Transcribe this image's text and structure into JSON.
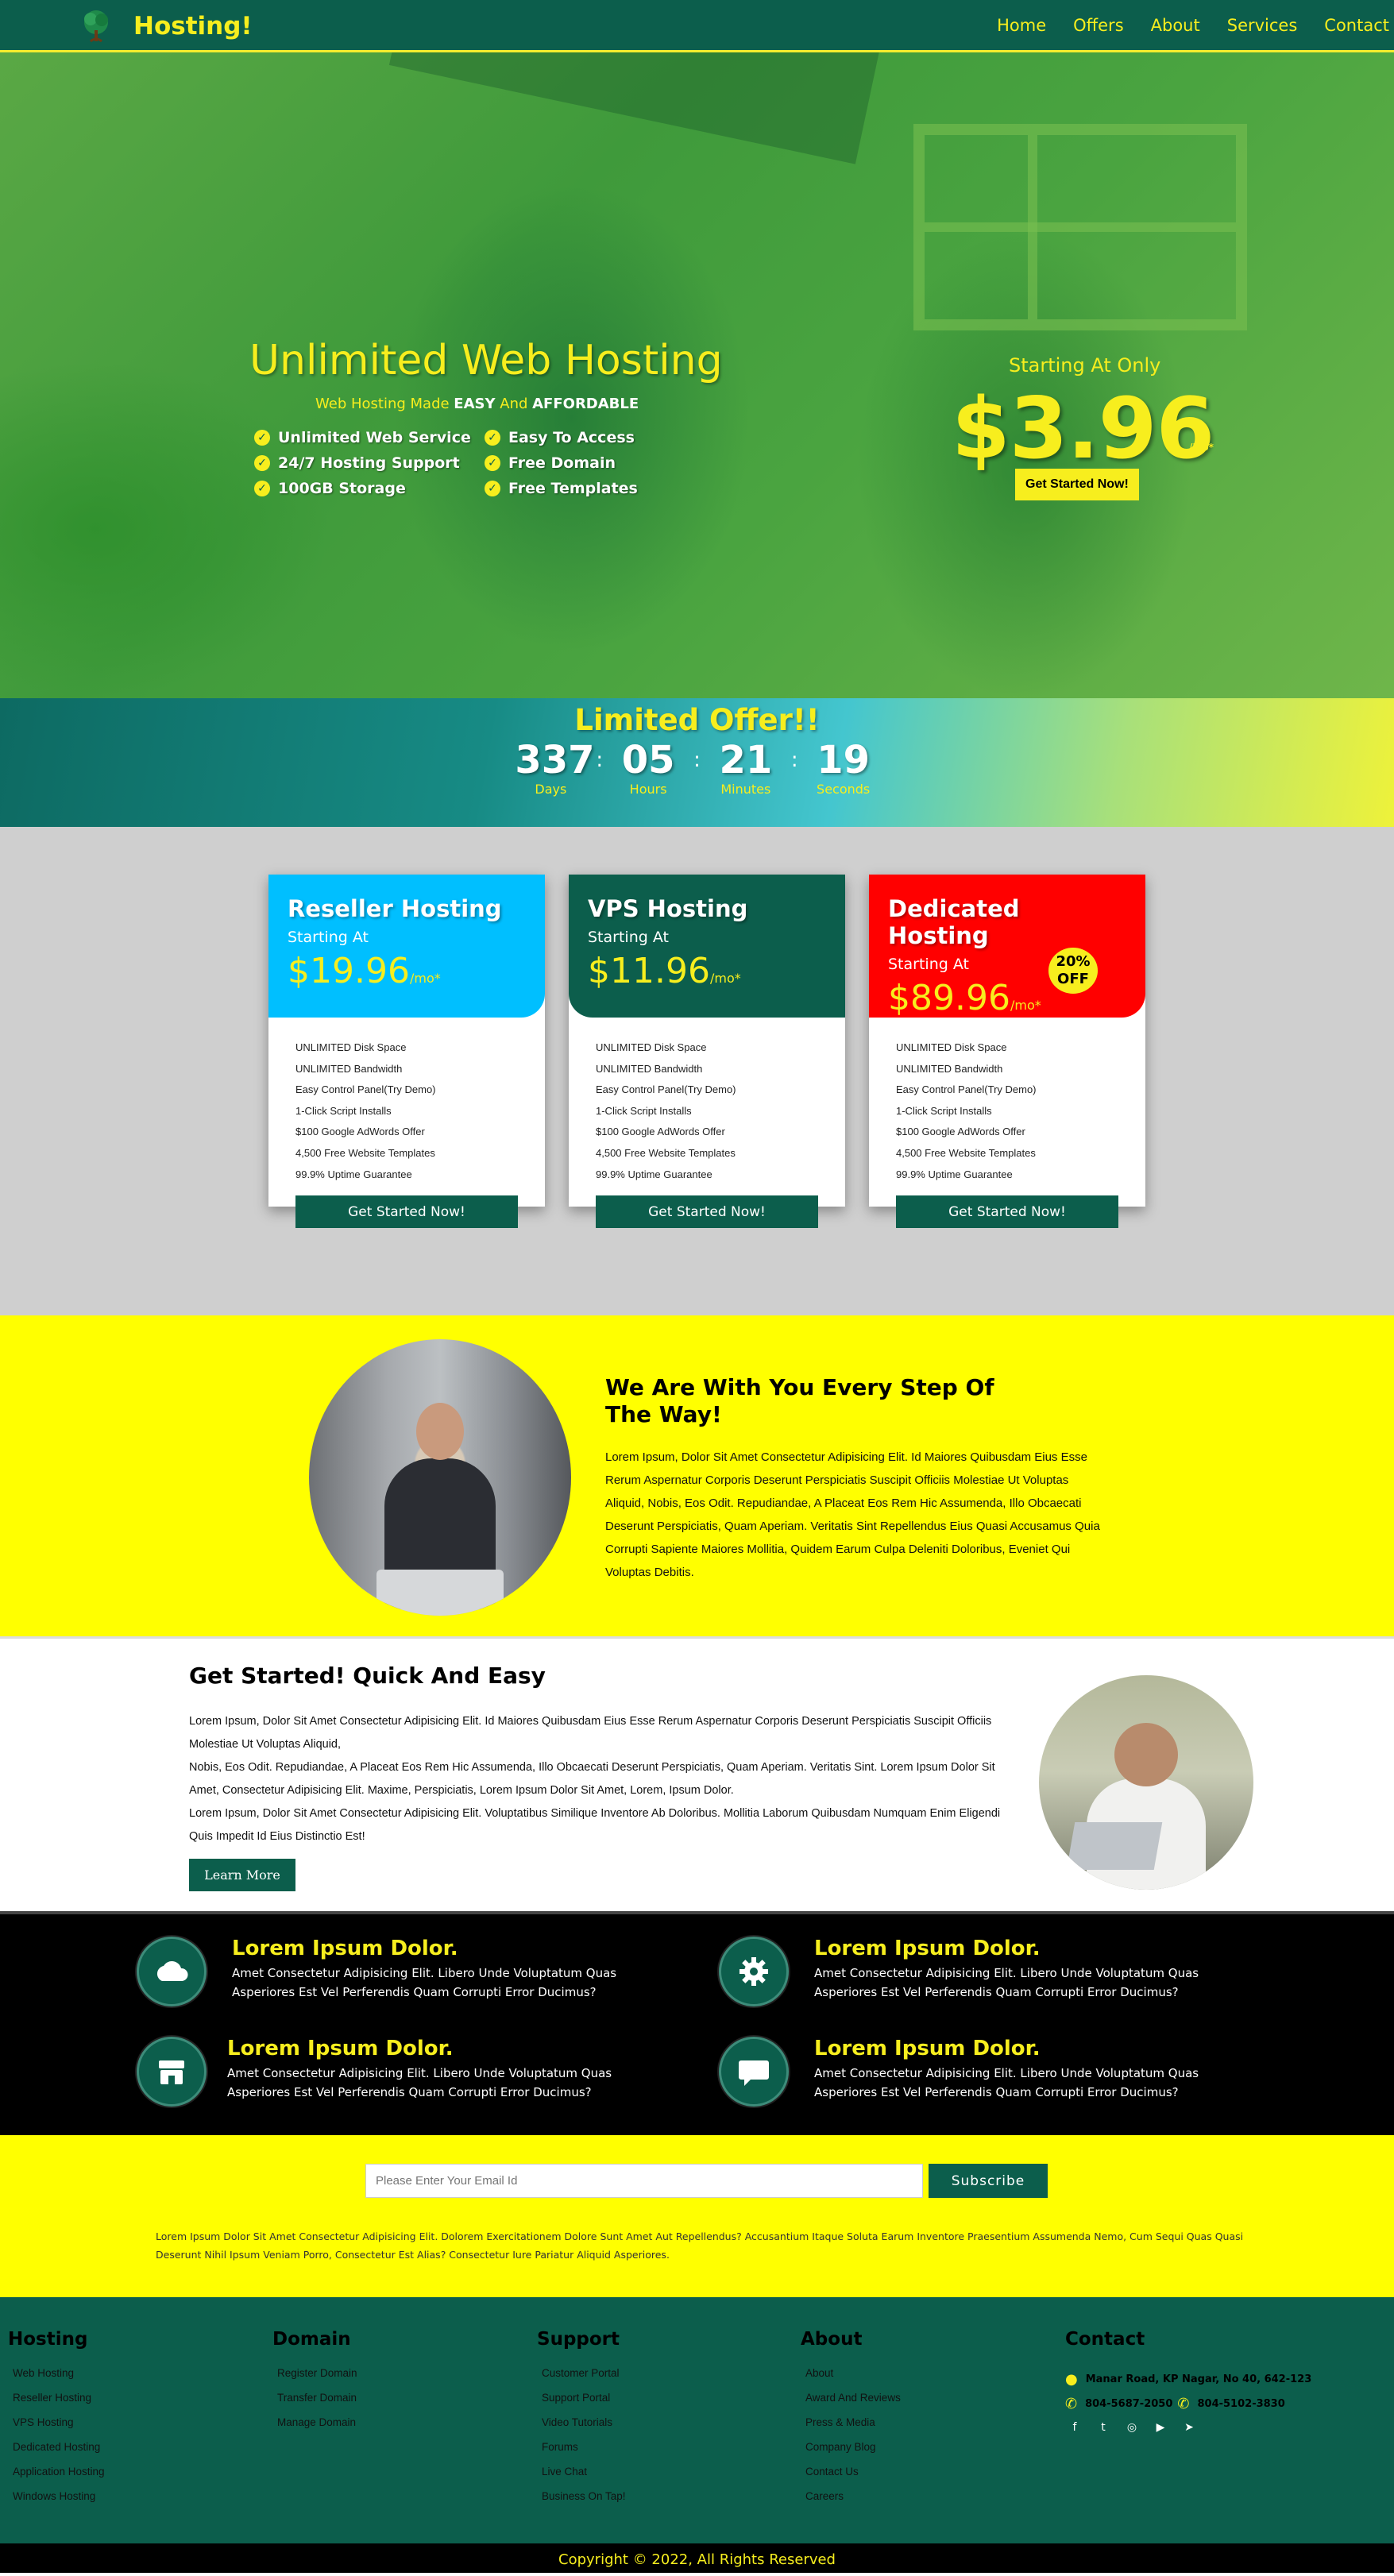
{
  "nav": {
    "brand": "Hosting!",
    "items": [
      "Home",
      "Offers",
      "About",
      "Services",
      "Contact"
    ]
  },
  "hero": {
    "title": "Unlimited Web Hosting",
    "tagline_pre": "Web Hosting Made ",
    "tagline_b1": "EASY",
    "tagline_mid": " And ",
    "tagline_b2": "AFFORDABLE",
    "features": [
      "Unlimited Web Service",
      "Easy To Access",
      "24/7 Hosting Support",
      "Free Domain",
      "100GB Storage",
      "Free Templates"
    ],
    "starting_label": "Starting At Only",
    "price": "$3.96",
    "price_unit": "/Mo*",
    "cta": "Get Started Now!"
  },
  "offer": {
    "title": "Limited Offer!!",
    "countdown": [
      {
        "value": "337",
        "label": "Days"
      },
      {
        "value": "05",
        "label": "Hours"
      },
      {
        "value": "21",
        "label": "Minutes"
      },
      {
        "value": "19",
        "label": "Seconds"
      }
    ],
    "separator": ":"
  },
  "pricing": {
    "plans": [
      {
        "name": "Reseller Hosting",
        "starting": "Starting At",
        "price": "$19.96",
        "unit": "/mo*",
        "badge": "",
        "color": "#00bfff"
      },
      {
        "name": "VPS Hosting",
        "starting": "Starting At",
        "price": "$11.96",
        "unit": "/mo*",
        "badge": "",
        "color": "#0c5e4c"
      },
      {
        "name": "Dedicated Hosting",
        "starting": "Starting At",
        "price": "$89.96",
        "unit": "/mo*",
        "badge": "20% OFF",
        "color": "#ff0000"
      }
    ],
    "features": [
      "UNLIMITED Disk Space",
      "UNLIMITED Bandwidth",
      "Easy Control Panel(Try Demo)",
      "1-Click Script Installs",
      "$100 Google AdWords Offer",
      "4,500 Free Website Templates",
      "99.9% Uptime Guarantee"
    ],
    "cta": "Get Started Now!"
  },
  "step": {
    "title": "We Are With You Every Step Of The Way!",
    "text": "Lorem Ipsum, Dolor Sit Amet Consectetur Adipisicing Elit. Id Maiores Quibusdam Eius Esse Rerum Aspernatur Corporis Deserunt Perspiciatis Suscipit Officiis Molestiae Ut Voluptas Aliquid, Nobis, Eos Odit. Repudiandae, A Placeat Eos Rem Hic Assumenda, Illo Obcaecati Deserunt Perspiciatis, Quam Aperiam. Veritatis Sint Repellendus Eius Quasi Accusamus Quia Corrupti Sapiente Maiores Mollitia, Quidem Earum Culpa Deleniti Doloribus, Eveniet Qui Voluptas Debitis."
  },
  "quick": {
    "title": "Get Started! Quick And Easy",
    "para1": "Lorem Ipsum, Dolor Sit Amet Consectetur Adipisicing Elit. Id Maiores Quibusdam Eius Esse Rerum Aspernatur Corporis Deserunt Perspiciatis Suscipit Officiis Molestiae Ut Voluptas Aliquid,",
    "para2": "Nobis, Eos Odit. Repudiandae, A Placeat Eos Rem Hic Assumenda, Illo Obcaecati Deserunt Perspiciatis, Quam Aperiam. Veritatis Sint. Lorem Ipsum Dolor Sit Amet, Consectetur Adipisicing Elit. Maxime, Perspiciatis, Lorem Ipsum Dolor Sit Amet, Lorem, Ipsum Dolor.",
    "para3": "Lorem Ipsum, Dolor Sit Amet Consectetur Adipisicing Elit. Voluptatibus Similique Inventore Ab Doloribus. Mollitia Laborum Quibusdam Numquam Enim Eligendi Quis Impedit Id Eius Distinctio Est!",
    "cta": "Learn More"
  },
  "features_block": {
    "items": [
      {
        "icon": "cloud-icon",
        "title": "Lorem Ipsum Dolor.",
        "text": "Amet Consectetur Adipisicing Elit. Libero Unde Voluptatum Quas Asperiores Est Vel Perferendis Quam Corrupti Error Ducimus?"
      },
      {
        "icon": "gear-icon",
        "title": "Lorem Ipsum Dolor.",
        "text": "Amet Consectetur Adipisicing Elit. Libero Unde Voluptatum Quas Asperiores Est Vel Perferendis Quam Corrupti Error Ducimus?"
      },
      {
        "icon": "store-icon",
        "title": "Lorem Ipsum Dolor.",
        "text": "Amet Consectetur Adipisicing Elit. Libero Unde Voluptatum Quas Asperiores Est Vel Perferendis Quam Corrupti Error Ducimus?"
      },
      {
        "icon": "chat-icon",
        "title": "Lorem Ipsum Dolor.",
        "text": "Amet Consectetur Adipisicing Elit. Libero Unde Voluptatum Quas Asperiores Est Vel Perferendis Quam Corrupti Error Ducimus?"
      }
    ]
  },
  "subscribe": {
    "placeholder": "Please Enter Your Email Id",
    "button": "Subscribe",
    "text": "Lorem Ipsum Dolor Sit Amet Consectetur Adipisicing Elit. Dolorem Exercitationem Dolore Sunt Amet Aut Repellendus? Accusantium Itaque Soluta Earum Inventore Praesentium Assumenda Nemo, Cum Sequi Quas Quasi Deserunt Nihil Ipsum Veniam Porro, Consectetur Est Alias? Consectetur Iure Pariatur Aliquid Asperiores."
  },
  "footer": {
    "hosting": {
      "title": "Hosting",
      "links": [
        "Web Hosting",
        "Reseller Hosting",
        "VPS Hosting",
        "Dedicated Hosting",
        "Application Hosting",
        "Windows Hosting"
      ]
    },
    "domain": {
      "title": "Domain",
      "links": [
        "Register Domain",
        "Transfer Domain",
        "Manage Domain"
      ]
    },
    "support": {
      "title": "Support",
      "links": [
        "Customer Portal",
        "Support Portal",
        "Video Tutorials",
        "Forums",
        "Live Chat",
        "Business On Tap!"
      ]
    },
    "about": {
      "title": "About",
      "links": [
        "About",
        "Award And Reviews",
        "Press & Media",
        "Company Blog",
        "Contact Us",
        "Careers"
      ]
    },
    "contact": {
      "title": "Contact",
      "address": "Manar Road, KP Nagar, No 40, 642-123",
      "phone1": "804-5687-2050",
      "phone2": "804-5102-3830",
      "socials": [
        "facebook-icon",
        "twitter-icon",
        "instagram-icon",
        "youtube-icon",
        "telegram-icon"
      ]
    }
  },
  "copyright": "Copyright © 2022, All Rights Reserved",
  "colors": {
    "primary": "#0c5e4c",
    "accent": "#f7ee1e",
    "yellow_bg": "#ffff00"
  }
}
